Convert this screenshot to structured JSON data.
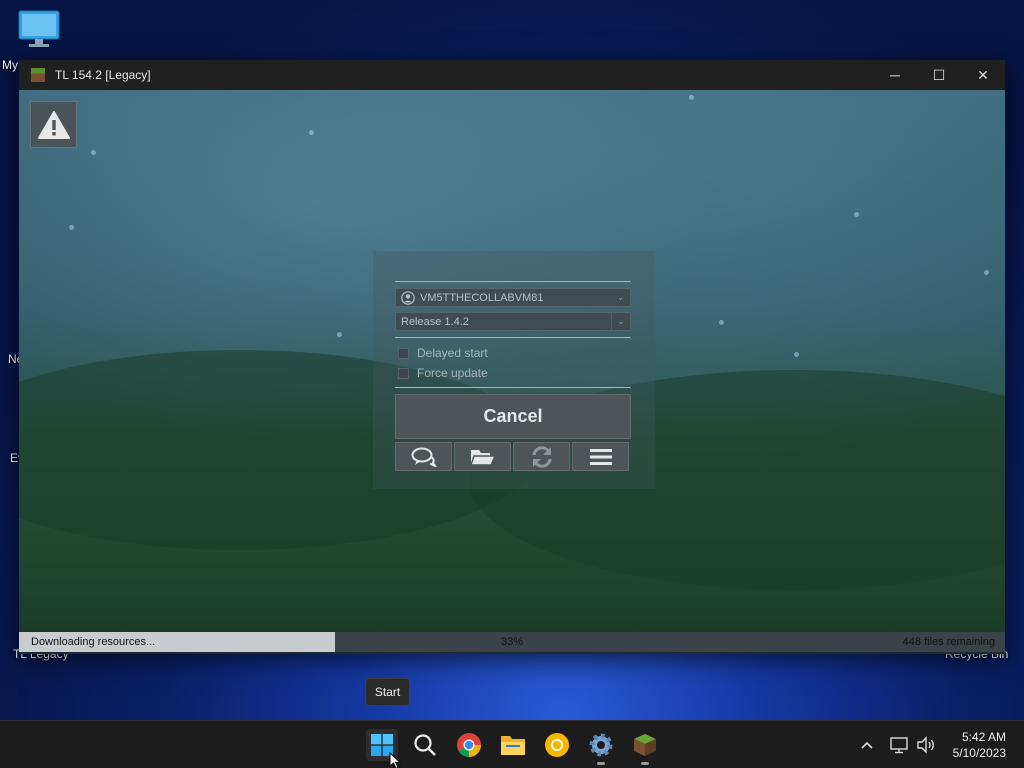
{
  "desktop": {
    "icons": [
      {
        "label": "My"
      },
      {
        "label": "Ne"
      },
      {
        "label": "Ev"
      },
      {
        "label": "TL Legacy"
      },
      {
        "label": "Recycle Bin"
      }
    ]
  },
  "window": {
    "title": "TL 154.2 [Legacy]",
    "controls": {
      "minimize": "─",
      "maximize": "☐",
      "close": "✕"
    }
  },
  "launcher": {
    "account": "VM5TTHECOLLABVM81",
    "version": "Release 1.4.2",
    "options": [
      {
        "label": "Delayed start",
        "checked": false
      },
      {
        "label": "Force update",
        "checked": false
      }
    ],
    "cancel_label": "Cancel",
    "tool_buttons": [
      "chat-icon",
      "folder-icon",
      "refresh-icon",
      "menu-icon"
    ]
  },
  "progress": {
    "status": "Downloading resources...",
    "percent_label": "33%",
    "value": 0.33,
    "remaining": "448 files remaining"
  },
  "taskbar": {
    "tooltip": "Start",
    "apps": [
      "start-icon",
      "search-icon",
      "chrome-icon",
      "file-explorer-icon",
      "chrome-canary-icon",
      "settings-icon",
      "tl-legacy-icon"
    ],
    "time": "5:42 AM",
    "date": "5/10/2023"
  },
  "colors": {
    "accent_blue": "#1e6fd9",
    "window_title_bg": "#202020",
    "taskbar_bg": "#1c1c1c"
  }
}
